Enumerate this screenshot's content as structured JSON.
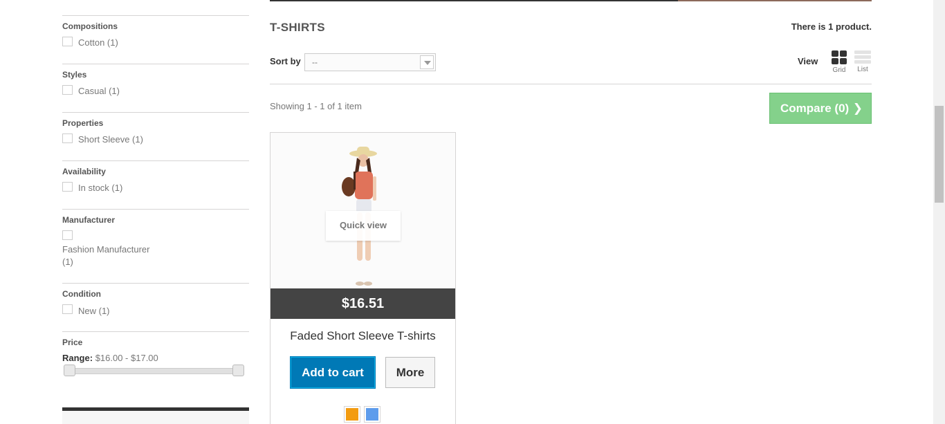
{
  "sidebar": {
    "filters": [
      {
        "title": "Compositions",
        "options": [
          "Cotton (1)"
        ]
      },
      {
        "title": "Styles",
        "options": [
          "Casual (1)"
        ]
      },
      {
        "title": "Properties",
        "options": [
          "Short Sleeve (1)"
        ]
      },
      {
        "title": "Availability",
        "options": [
          "In stock (1)"
        ]
      },
      {
        "title": "Manufacturer",
        "options": [
          "Fashion Manufacturer (1)"
        ]
      },
      {
        "title": "Condition",
        "options": [
          "New (1)"
        ]
      }
    ],
    "price": {
      "title": "Price",
      "range_label": "Range:",
      "range_value": "$16.00 - $17.00",
      "min": 16.0,
      "max": 17.0
    }
  },
  "main": {
    "category_title": "T-SHIRTS",
    "product_count": "There is 1 product.",
    "sort_label": "Sort by",
    "sort_value": "--",
    "view_label": "View",
    "view_grid_label": "Grid",
    "view_list_label": "List",
    "showing": "Showing 1 - 1 of 1 item",
    "compare_label": "Compare (0)",
    "product": {
      "name": "Faded Short Sleeve T-shirts",
      "price": "$16.51",
      "quick_view_label": "Quick view",
      "add_to_cart_label": "Add to cart",
      "more_label": "More",
      "swatches": [
        "#f39c11",
        "#5d9cec"
      ]
    }
  },
  "colors": {
    "compare_bg": "#84d18b",
    "add_to_cart_bg": "#0079b6",
    "price_bar_bg": "#444444"
  }
}
